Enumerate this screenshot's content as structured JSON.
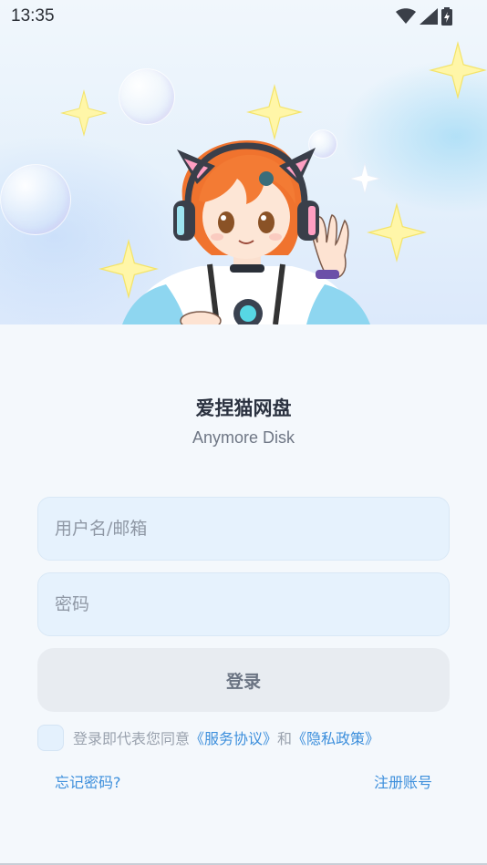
{
  "status_bar": {
    "time": "13:35",
    "icons": [
      "wifi-icon",
      "cellular-signal-icon",
      "battery-charging-icon"
    ]
  },
  "app": {
    "title": "爱捏猫网盘",
    "subtitle": "Anymore Disk"
  },
  "form": {
    "username_placeholder": "用户名/邮箱",
    "username_value": "",
    "password_placeholder": "密码",
    "password_value": "",
    "login_label": "登录"
  },
  "agreement": {
    "checked": false,
    "prefix": "登录即代表您同意",
    "service_link": "《服务协议》",
    "connector": "和",
    "privacy_link": "《隐私政策》"
  },
  "links": {
    "forgot_password": "忘记密码?",
    "register": "注册账号"
  },
  "colors": {
    "accent": "#3d8fdc",
    "input_bg": "#e6f2fd",
    "button_bg": "#e8ecf1",
    "background": "#f4f8fc"
  }
}
